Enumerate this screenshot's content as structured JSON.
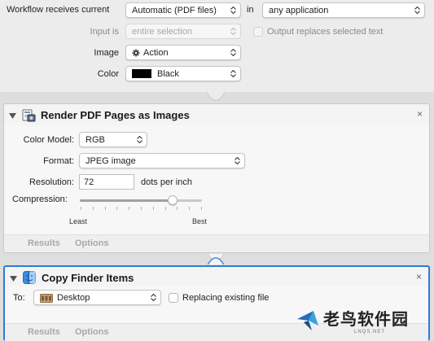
{
  "workflow_settings": {
    "receives_label": "Workflow receives current",
    "receives_value": "Automatic (PDF files)",
    "in_label": "in",
    "app_value": "any application",
    "input_is_label": "Input is",
    "input_is_value": "entire selection",
    "output_replaces_label": "Output replaces selected text",
    "image_label": "Image",
    "image_value": "Action",
    "color_label": "Color",
    "color_value": "Black",
    "color_swatch": "#000000"
  },
  "render_action": {
    "title": "Render PDF Pages as Images",
    "close_glyph": "×",
    "color_model_label": "Color Model:",
    "color_model_value": "RGB",
    "format_label": "Format:",
    "format_value": "JPEG image",
    "resolution_label": "Resolution:",
    "resolution_value": "72",
    "resolution_unit": "dots per inch",
    "compression_label": "Compression:",
    "compression_level": 0.76,
    "slider_min_label": "Least",
    "slider_max_label": "Best",
    "footer_results": "Results",
    "footer_options": "Options"
  },
  "copy_action": {
    "title": "Copy Finder Items",
    "close_glyph": "×",
    "to_label": "To:",
    "to_value": "Desktop",
    "replacing_label": "Replacing existing file",
    "footer_results": "Results",
    "footer_options": "Options"
  },
  "watermark": {
    "text": "老鸟软件园",
    "sub": "LNQS.NET"
  },
  "colors": {
    "selected_border": "#2e7bd6"
  }
}
